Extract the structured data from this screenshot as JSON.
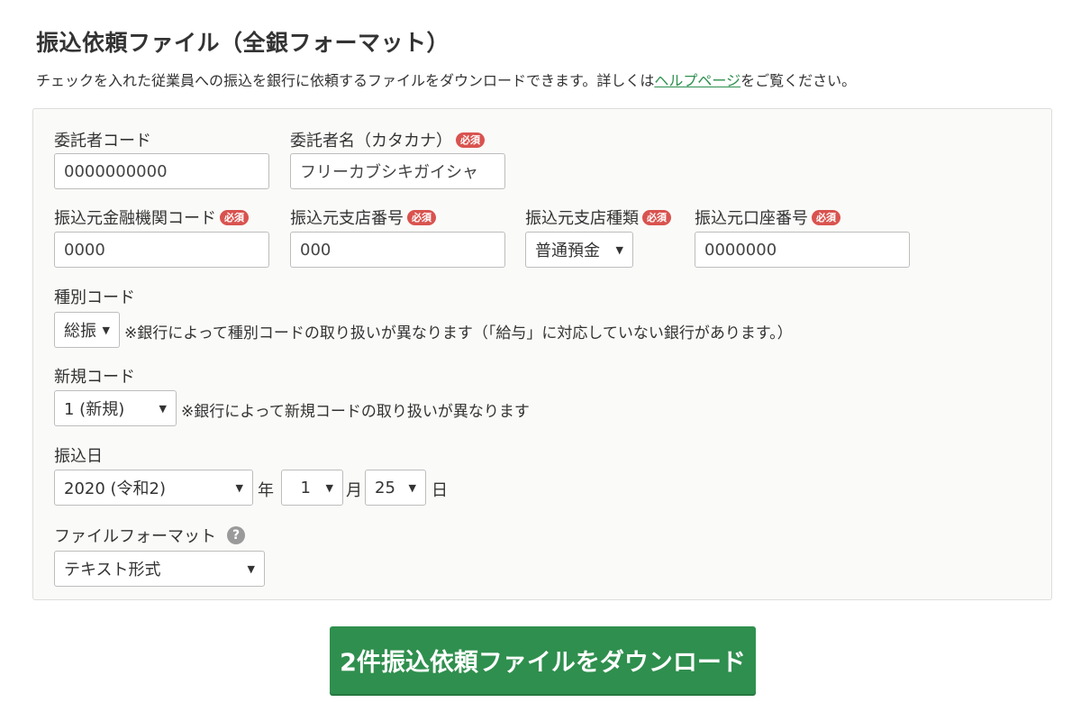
{
  "page": {
    "title": "振込依頼ファイル（全銀フォーマット）",
    "description_prefix": "チェックを入れた従業員への振込を銀行に依頼するファイルをダウンロードできます。詳しくは",
    "help_link": "ヘルプページ",
    "description_suffix": "をご覧ください。"
  },
  "required_badge": "必須",
  "form": {
    "consignor_code": {
      "label": "委託者コード",
      "value": "0000000000"
    },
    "consignor_name": {
      "label": "委託者名（カタカナ）",
      "value": "フリーカブシキガイシャ",
      "required": true
    },
    "bank_code": {
      "label": "振込元金融機関コード",
      "value": "0000",
      "required": true
    },
    "branch_code": {
      "label": "振込元支店番号",
      "value": "000",
      "required": true
    },
    "account_type": {
      "label": "振込元支店種類",
      "value": "普通預金",
      "required": true
    },
    "account_number": {
      "label": "振込元口座番号",
      "value": "0000000",
      "required": true
    },
    "type_code": {
      "label": "種別コード",
      "value": "総振",
      "note": "※銀行によって種別コードの取り扱いが異なります（「給与」に対応していない銀行があります。）"
    },
    "new_code": {
      "label": "新規コード",
      "value": "1 (新規)",
      "note": "※銀行によって新規コードの取り扱いが異なります"
    },
    "transfer_date": {
      "label": "振込日",
      "year": "2020 (令和2)",
      "year_unit": "年",
      "month": "1",
      "month_unit": "月",
      "day": "25",
      "day_unit": "日"
    },
    "file_format": {
      "label": "ファイルフォーマット",
      "value": "テキスト形式",
      "help_icon": "?"
    }
  },
  "download_button": "2件振込依頼ファイルをダウンロード",
  "colors": {
    "accent": "#2f8f4e",
    "badge": "#d9534f",
    "link": "#2d8f4e",
    "panel_bg": "#fafaf8"
  }
}
